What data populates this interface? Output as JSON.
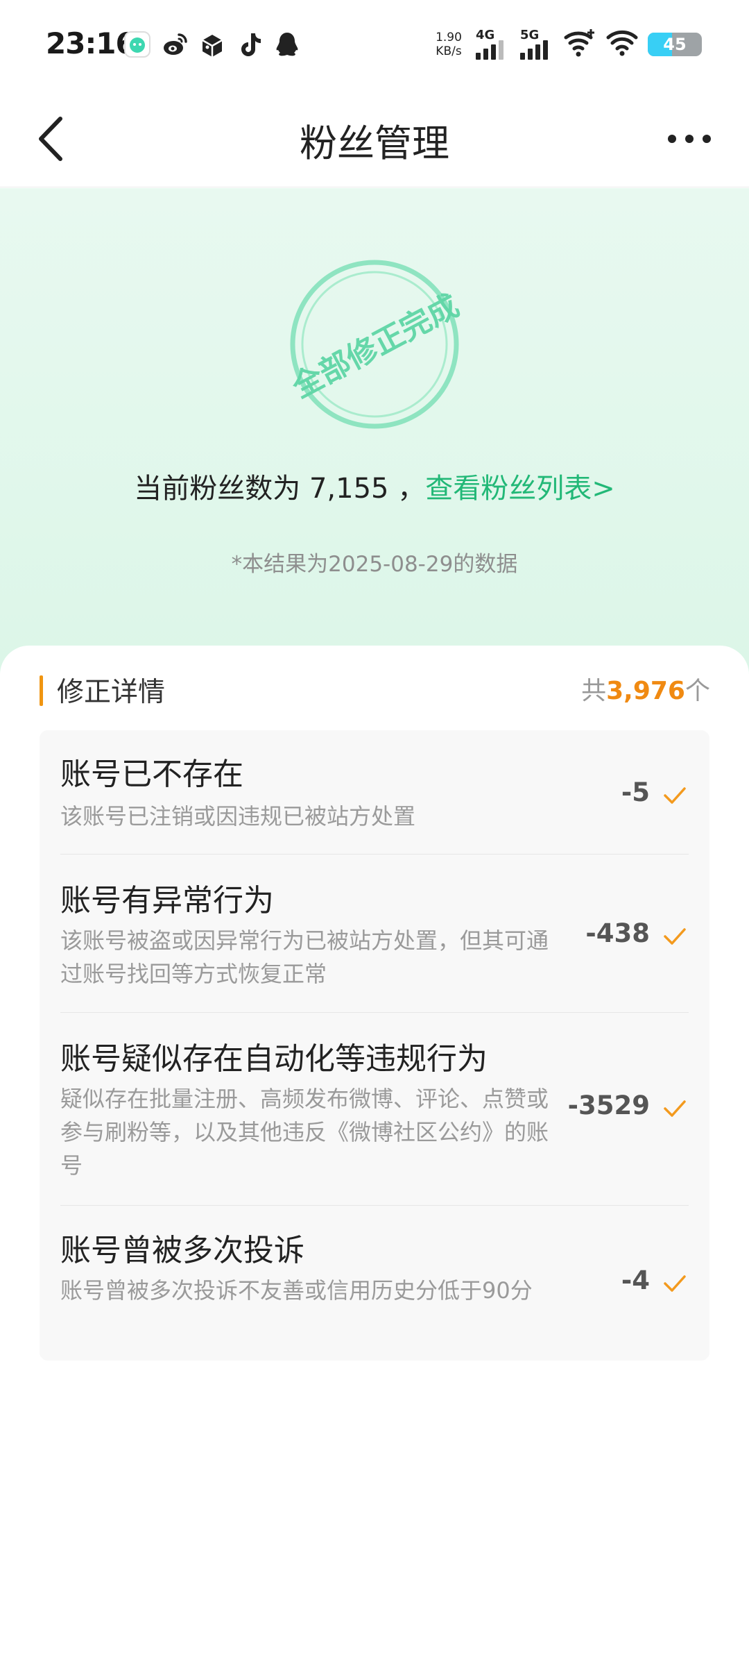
{
  "status_bar": {
    "time": "23:16",
    "net_speed_value": "1.90",
    "net_speed_unit": "KB/s",
    "signal_1": "4G",
    "signal_2": "5G",
    "battery": "45",
    "app_icons": [
      "app-notification-icon",
      "weibo-icon",
      "package-icon",
      "tiktok-icon",
      "qq-icon"
    ]
  },
  "nav": {
    "title": "粉丝管理"
  },
  "hero": {
    "stamp_text": "全部修正完成",
    "fans_prefix": "当前粉丝数为 ",
    "fans_count": "7,155",
    "fans_sep": " ，",
    "fans_link": "查看粉丝列表>",
    "data_note": "*本结果为2025-08-29的数据"
  },
  "section": {
    "title": "修正详情",
    "total_prefix": "共",
    "total_count": "3,976",
    "total_suffix": "个"
  },
  "rows": [
    {
      "title": "账号已不存在",
      "desc": "该账号已注销或因违规已被站方处置",
      "count": "-5"
    },
    {
      "title": "账号有异常行为",
      "desc": "该账号被盗或因异常行为已被站方处置，但其可通过账号找回等方式恢复正常",
      "count": "-438"
    },
    {
      "title": "账号疑似存在自动化等违规行为",
      "desc": "疑似存在批量注册、高频发布微博、评论、点赞或参与刷粉等，以及其他违反《微博社区公约》的账号",
      "count": "-3529"
    },
    {
      "title": "账号曾被多次投诉",
      "desc": "账号曾被多次投诉不友善或信用历史分低于90分",
      "count": "-4"
    }
  ],
  "colors": {
    "accent_green": "#22b877",
    "accent_orange": "#f08a12",
    "stamp_green": "#5fd6a6"
  }
}
